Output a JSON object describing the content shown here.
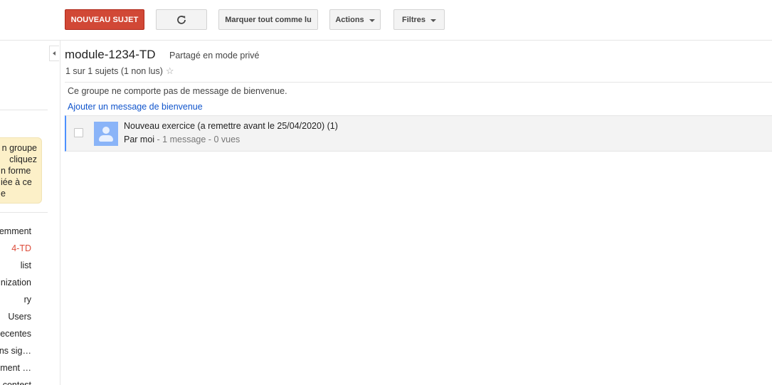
{
  "toolbar": {
    "new_topic_label": "NOUVEAU SUJET",
    "refresh_icon": "refresh-icon",
    "mark_all_read_label": "Marquer tout comme lu",
    "actions_label": "Actions",
    "filters_label": "Filtres"
  },
  "sidebar": {
    "notice_lines": [
      "n groupe",
      "cliquez",
      "n forme",
      "iée à ce",
      "e"
    ],
    "groups": [
      {
        "label": "emment",
        "active": false
      },
      {
        "label": "4-TD",
        "active": true
      },
      {
        "label": "list",
        "active": false
      },
      {
        "label": "nization",
        "active": false
      },
      {
        "label": "ry",
        "active": false
      },
      {
        "label": "Users",
        "active": false
      },
      {
        "label": "ecentes",
        "active": false
      },
      {
        "label": "ns sig…",
        "active": false
      },
      {
        "label": "ment …",
        "active": false
      },
      {
        "label": "contest",
        "active": false
      }
    ],
    "active_color": "#dd4b39"
  },
  "main": {
    "group_name": "module-1234-TD",
    "sharing": "Partagé en mode privé",
    "topic_count": "1 sur 1 sujets (1 non lus)",
    "star": "☆",
    "welcome_text": "Ce groupe ne comporte pas de message de bienvenue.",
    "add_welcome": "Ajouter un message de bienvenue",
    "topics": [
      {
        "title": "Nouveau exercice (a remettre avant le 25/04/2020)  (1)",
        "author": "Par moi",
        "meta": " - 1 message - 0 vues"
      }
    ]
  },
  "colors": {
    "accent_red": "#d14836",
    "link_blue": "#1155cc",
    "unread_border": "#4d90fe",
    "notice_bg": "#fcf0c8"
  }
}
